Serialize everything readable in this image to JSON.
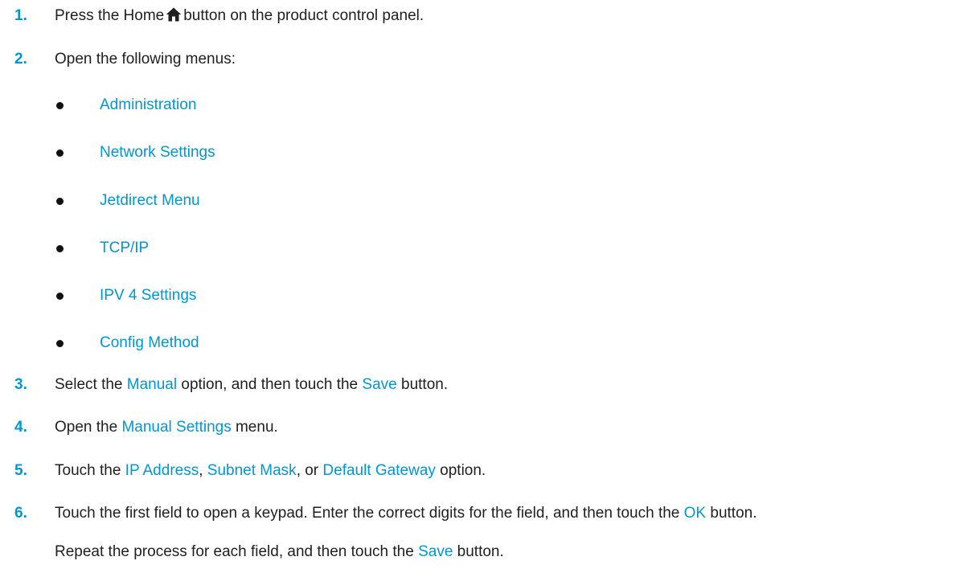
{
  "steps": [
    {
      "number": "1.",
      "before": "Press the Home",
      "icon": "home-icon",
      "after": "button on the product control panel."
    },
    {
      "number": "2.",
      "text": "Open the following menus:",
      "menus": [
        "Administration",
        "Network Settings",
        "Jetdirect Menu",
        "TCP/IP",
        "IPV 4 Settings",
        "Config Method"
      ]
    },
    {
      "number": "3.",
      "t1": "Select the ",
      "ui1": "Manual",
      "t2": " option, and then touch the ",
      "ui2": "Save",
      "t3": " button."
    },
    {
      "number": "4.",
      "t1": "Open the ",
      "ui1": "Manual Settings",
      "t2": " menu."
    },
    {
      "number": "5.",
      "t1": "Touch the ",
      "ui1": "IP Address",
      "t2": ", ",
      "ui2": "Subnet Mask",
      "t3": ", or ",
      "ui3": "Default Gateway",
      "t4": " option."
    },
    {
      "number": "6.",
      "t1": "Touch the first field to open a keypad. Enter the correct digits for the field, and then touch the ",
      "ui1": "OK",
      "t2": " button.",
      "cont1": "Repeat the process for each field, and then touch the ",
      "cont_ui": "Save",
      "cont2": " button."
    }
  ],
  "colors": {
    "accent": "#0096d6",
    "text": "#1f1f1f"
  }
}
